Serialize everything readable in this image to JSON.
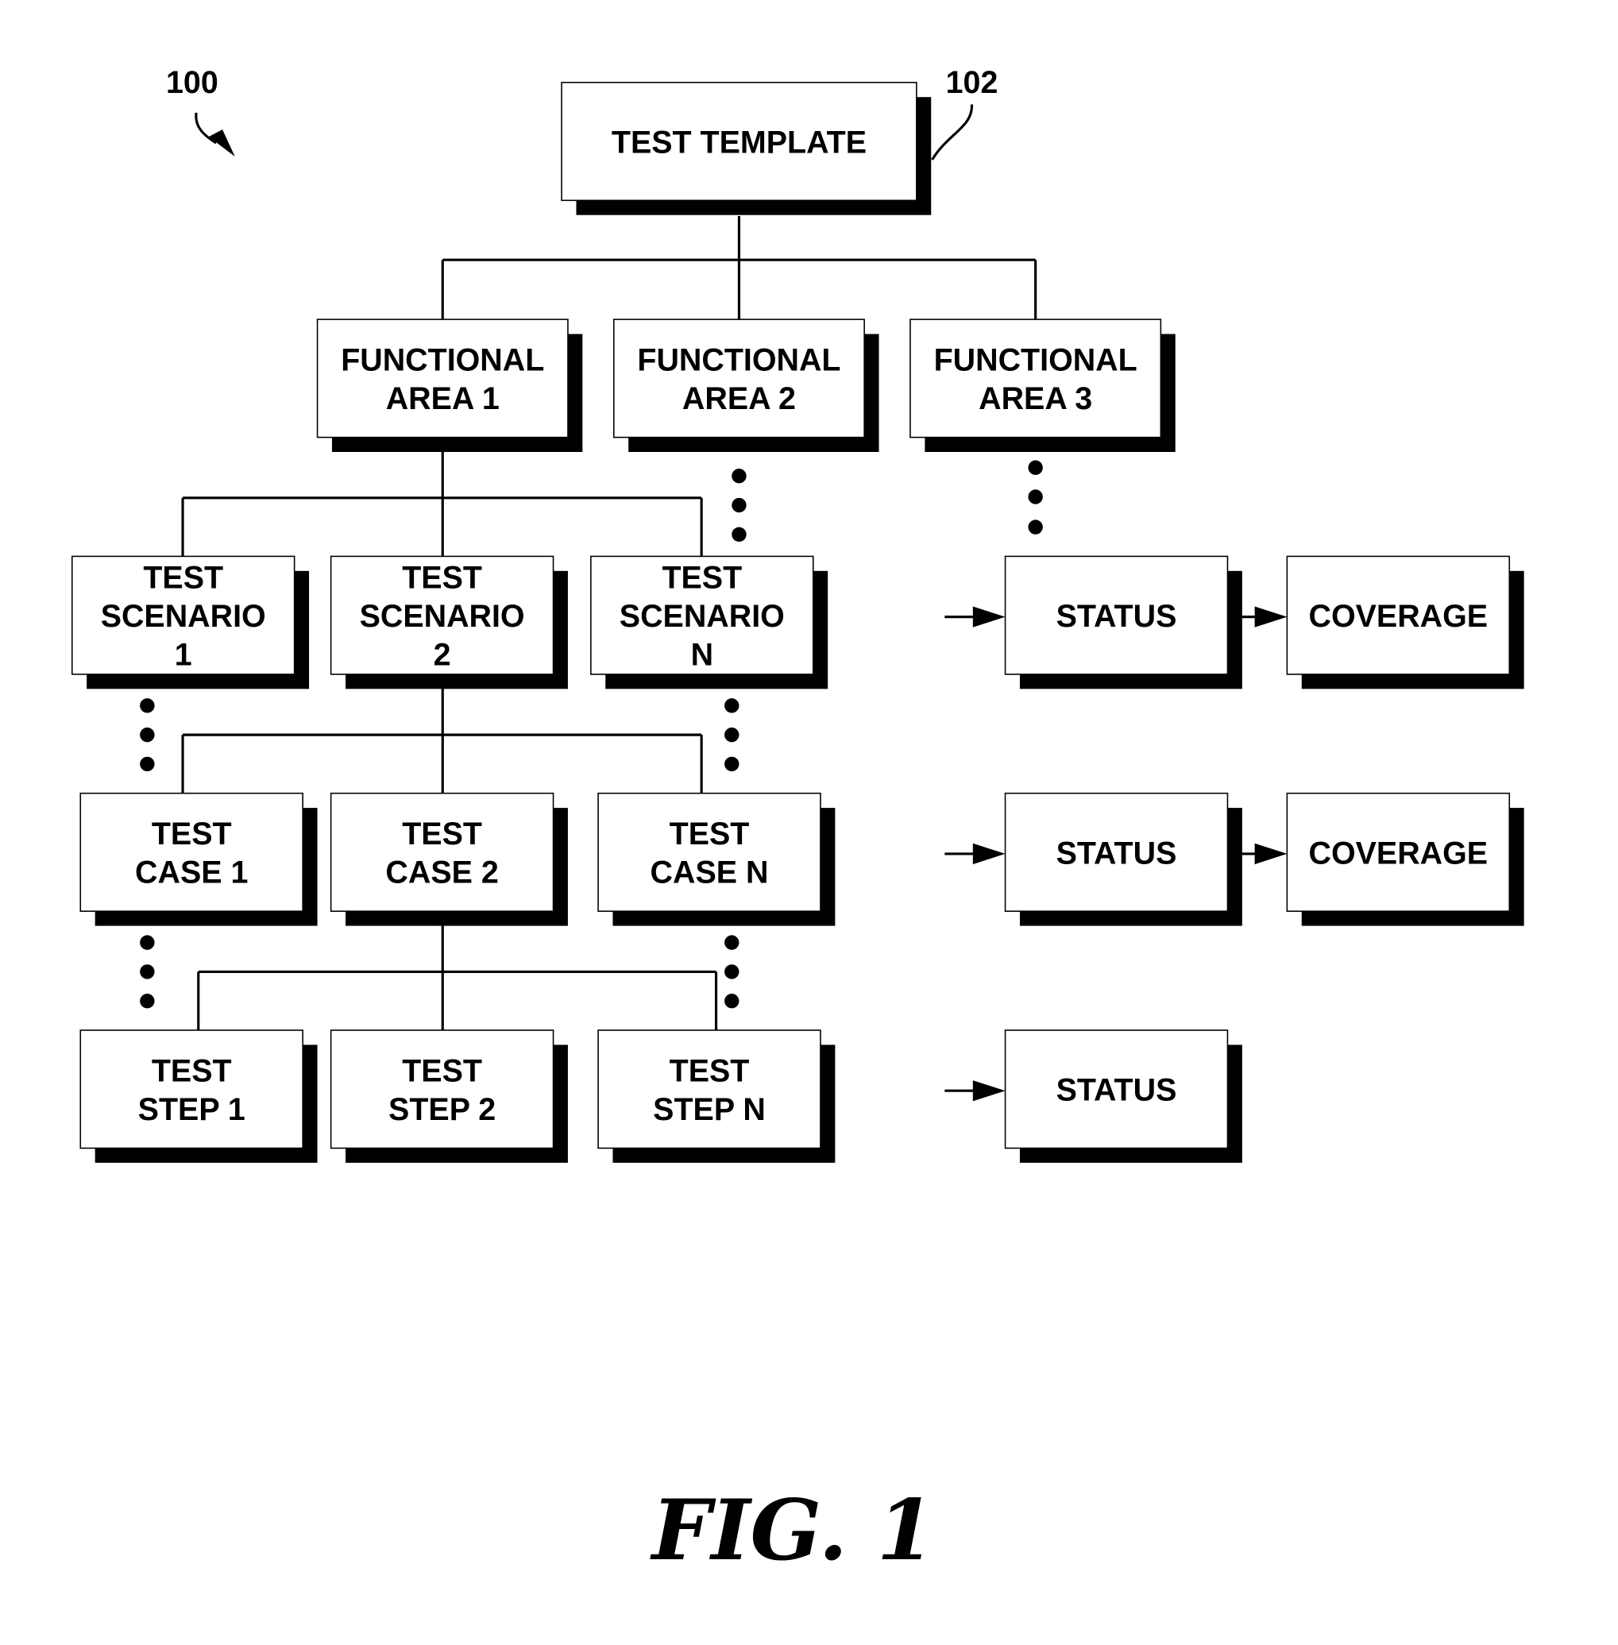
{
  "figure": {
    "reference_number": "100",
    "template_reference_number": "102",
    "caption": "FIG. 1"
  },
  "nodes": {
    "test_template": [
      "TEST TEMPLATE"
    ],
    "functional_areas": [
      [
        "FUNCTIONAL",
        "AREA 1"
      ],
      [
        "FUNCTIONAL",
        "AREA 2"
      ],
      [
        "FUNCTIONAL",
        "AREA 3"
      ]
    ],
    "test_scenarios": [
      [
        "TEST",
        "SCENARIO",
        "1"
      ],
      [
        "TEST",
        "SCENARIO",
        "2"
      ],
      [
        "TEST",
        "SCENARIO",
        "N"
      ]
    ],
    "test_cases": [
      [
        "TEST",
        "CASE 1"
      ],
      [
        "TEST",
        "CASE 2"
      ],
      [
        "TEST",
        "CASE N"
      ]
    ],
    "test_steps": [
      [
        "TEST",
        "STEP 1"
      ],
      [
        "TEST",
        "STEP 2"
      ],
      [
        "TEST",
        "STEP N"
      ]
    ],
    "status_label": "STATUS",
    "coverage_label": "COVERAGE"
  }
}
